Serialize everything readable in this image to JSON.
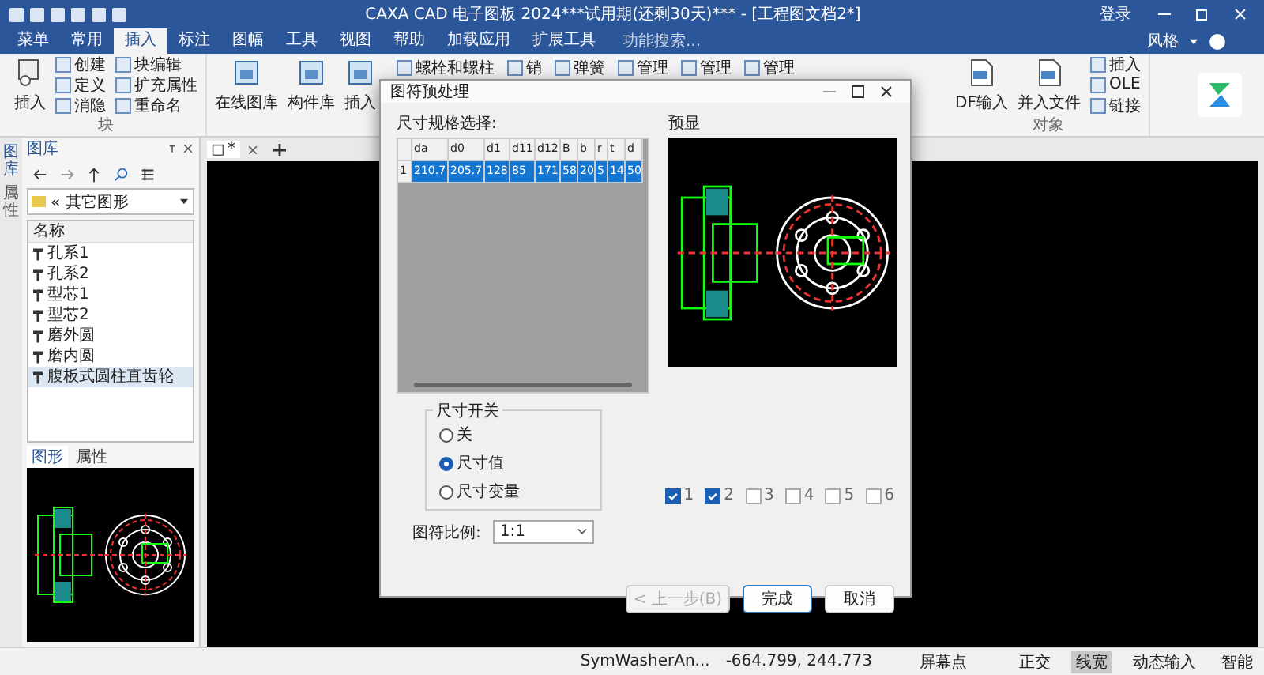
{
  "window": {
    "title": "CAXA CAD 电子图板 2024***试用期(还剩30天)*** - [工程图文档2*]",
    "login": "登录",
    "style_menu": "风格"
  },
  "menu_tabs": [
    {
      "label": "菜单",
      "selected": false
    },
    {
      "label": "常用",
      "selected": false
    },
    {
      "label": "插入",
      "selected": true
    },
    {
      "label": "标注",
      "selected": false
    },
    {
      "label": "图幅",
      "selected": false
    },
    {
      "label": "工具",
      "selected": false
    },
    {
      "label": "视图",
      "selected": false
    },
    {
      "label": "帮助",
      "selected": false
    },
    {
      "label": "加载应用",
      "selected": false
    },
    {
      "label": "扩展工具",
      "selected": false
    }
  ],
  "search": {
    "placeholder": "功能搜索..."
  },
  "ribbon": {
    "block_group": {
      "label": "块",
      "big": "插入",
      "small": [
        [
          "创建",
          "定义",
          "消隐"
        ],
        [
          "块编辑",
          "扩充属性",
          "重命名"
        ]
      ]
    },
    "library_big": [
      "在线图库",
      "构件库",
      "插入"
    ],
    "library_row": [
      "螺栓和螺柱",
      "销",
      "弹簧",
      "管理",
      "管理",
      "管理"
    ],
    "object_group": {
      "label": "对象",
      "big": [
        "DF输入",
        "并入文件"
      ],
      "small": [
        "插入",
        "OLE",
        "链接"
      ]
    }
  },
  "side_tabs": [
    {
      "label": "图库",
      "selected": true
    },
    {
      "label": "属性",
      "selected": false
    }
  ],
  "library_panel": {
    "title": "图库",
    "path": "« 其它图形",
    "column": "名称",
    "items": [
      {
        "label": "孔系1",
        "selected": false
      },
      {
        "label": "孔系2",
        "selected": false
      },
      {
        "label": "型芯1",
        "selected": false
      },
      {
        "label": "型芯2",
        "selected": false
      },
      {
        "label": "磨外圆",
        "selected": false
      },
      {
        "label": "磨内圆",
        "selected": false
      },
      {
        "label": "腹板式圆柱直齿轮",
        "selected": true
      }
    ],
    "tabs": [
      {
        "label": "图形",
        "selected": true
      },
      {
        "label": "属性",
        "selected": false
      }
    ]
  },
  "document_tab": {
    "label": "*"
  },
  "dialog": {
    "title": "图符预处理",
    "spec_label": "尺寸规格选择:",
    "columns": [
      "da",
      "d0",
      "d1",
      "d11",
      "d12",
      "B",
      "b",
      "r",
      "t",
      "d"
    ],
    "rows": [
      {
        "index": "1",
        "selected": true,
        "cells": [
          "210.7",
          "205.7",
          "128",
          "85",
          "171",
          "58",
          "20",
          "5",
          "14",
          "50"
        ]
      }
    ],
    "preview_label": "预显",
    "dim_switch": {
      "label": "尺寸开关",
      "options": [
        {
          "label": "关",
          "selected": false
        },
        {
          "label": "尺寸值",
          "selected": true
        },
        {
          "label": "尺寸变量",
          "selected": false
        }
      ]
    },
    "layers": [
      {
        "label": "1",
        "checked": true
      },
      {
        "label": "2",
        "checked": true
      },
      {
        "label": "3",
        "checked": false
      },
      {
        "label": "4",
        "checked": false
      },
      {
        "label": "5",
        "checked": false
      },
      {
        "label": "6",
        "checked": false
      }
    ],
    "scale": {
      "label": "图符比例:",
      "value": "1:1"
    },
    "buttons": [
      {
        "label": "< 上一步(B)",
        "kind": "back",
        "disabled": true
      },
      {
        "label": "完成",
        "kind": "primary",
        "disabled": false
      },
      {
        "label": "取消",
        "kind": "cancel",
        "disabled": false
      }
    ]
  },
  "status_bar": {
    "symbol": "SymWasherAn...",
    "coords": "-664.799, 244.773",
    "snap": "屏幕点",
    "toggles": [
      {
        "label": "正交",
        "on": false
      },
      {
        "label": "线宽",
        "on": true
      },
      {
        "label": "动态输入",
        "on": false
      },
      {
        "label": "智能",
        "on": false
      }
    ]
  }
}
